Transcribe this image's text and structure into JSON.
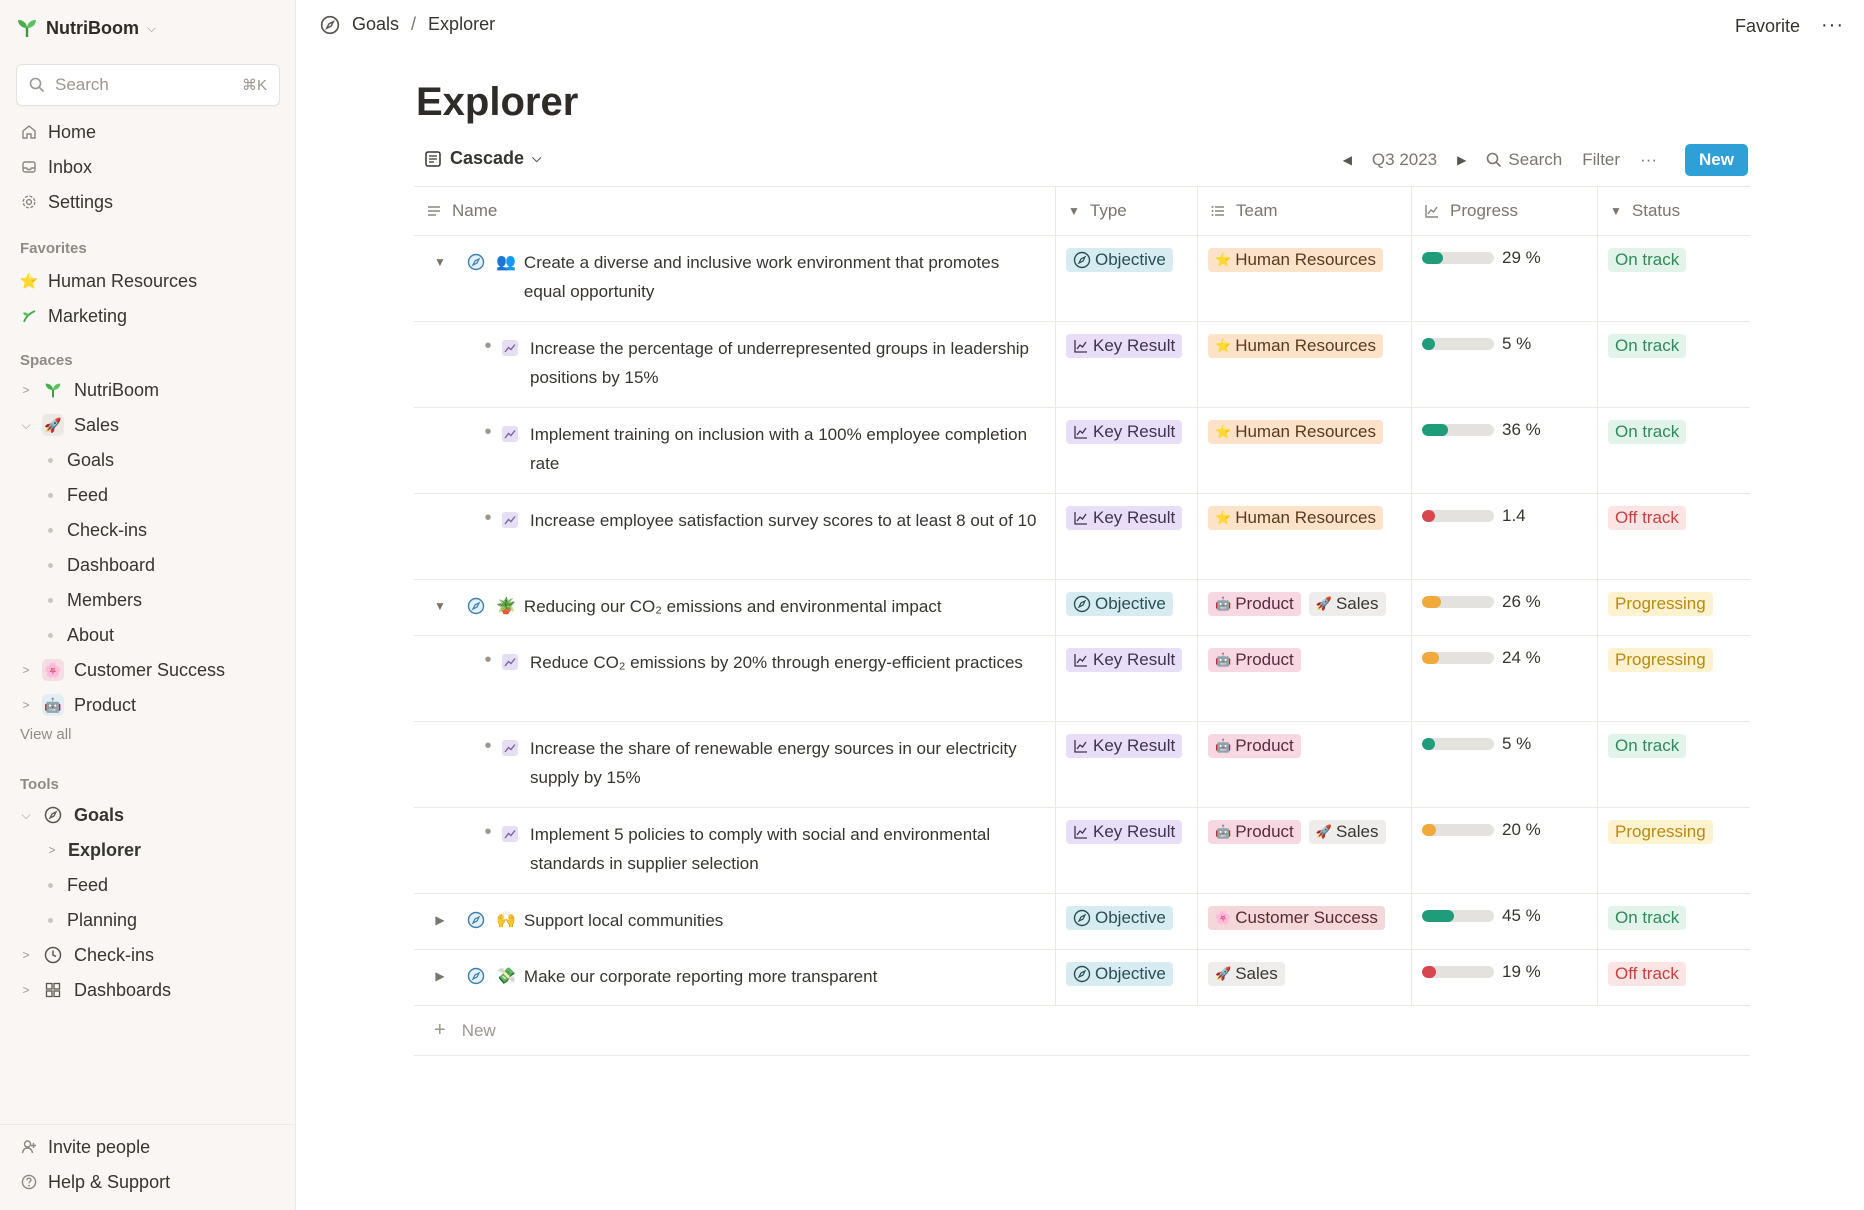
{
  "workspace": {
    "name": "NutriBoom"
  },
  "sidebar": {
    "search_placeholder": "Search",
    "search_shortcut": "⌘K",
    "nav": [
      {
        "label": "Home",
        "icon": "home-icon"
      },
      {
        "label": "Inbox",
        "icon": "inbox-icon"
      },
      {
        "label": "Settings",
        "icon": "gear-icon"
      }
    ],
    "favorites_heading": "Favorites",
    "favorites": [
      {
        "label": "Human Resources",
        "icon": "star-emoji"
      },
      {
        "label": "Marketing",
        "icon": "sprout-emoji"
      }
    ],
    "spaces_heading": "Spaces",
    "spaces": {
      "nutriboom": "NutriBoom",
      "sales": "Sales",
      "sales_children": [
        "Goals",
        "Feed",
        "Check-ins",
        "Dashboard",
        "Members",
        "About"
      ],
      "customer_success": "Customer Success",
      "product": "Product"
    },
    "view_all": "View all",
    "tools_heading": "Tools",
    "tools": {
      "goals": "Goals",
      "goals_children": [
        "Explorer",
        "Feed",
        "Planning"
      ],
      "checkins": "Check-ins",
      "dashboards": "Dashboards"
    },
    "bottom": {
      "invite": "Invite people",
      "help": "Help & Support"
    }
  },
  "topbar": {
    "breadcrumb": [
      "Goals",
      "Explorer"
    ],
    "breadcrumb_sep": "/",
    "favorite": "Favorite",
    "more": "···"
  },
  "page": {
    "title": "Explorer",
    "view": "Cascade",
    "period": "Q3 2023",
    "search": "Search",
    "filter": "Filter",
    "more": "···",
    "new_button": "New"
  },
  "table": {
    "columns": {
      "name": "Name",
      "type": "Type",
      "team": "Team",
      "progress": "Progress",
      "status": "Status"
    },
    "rows": [
      {
        "kind": "objective",
        "expanded": true,
        "emoji": "👥",
        "name": "Create a diverse and inclusive work environment that promotes equal opportunity",
        "type": "Objective",
        "teams": [
          {
            "label": "Human Resources",
            "emoji": "⭐",
            "cls": "tag-hr"
          }
        ],
        "progress": 0.29,
        "progress_label": "29 %",
        "status": "On track",
        "status_cls": "st-on",
        "color": "#1f9d7a",
        "height": 86
      },
      {
        "kind": "kr",
        "name": "Increase the percentage of underrepresented groups in leadership positions by 15%",
        "type": "Key Result",
        "teams": [
          {
            "label": "Human Resources",
            "emoji": "⭐",
            "cls": "tag-hr"
          }
        ],
        "progress": 0.05,
        "progress_label": "5 %",
        "status": "On track",
        "status_cls": "st-on",
        "color": "#1f9d7a",
        "height": 86
      },
      {
        "kind": "kr",
        "name": "Implement training on inclusion with a 100% employee completion rate",
        "type": "Key Result",
        "teams": [
          {
            "label": "Human Resources",
            "emoji": "⭐",
            "cls": "tag-hr"
          }
        ],
        "progress": 0.36,
        "progress_label": "36 %",
        "status": "On track",
        "status_cls": "st-on",
        "color": "#1f9d7a",
        "height": 86
      },
      {
        "kind": "kr",
        "name": "Increase employee satisfaction survey scores to at least 8 out of 10",
        "type": "Key Result",
        "teams": [
          {
            "label": "Human Resources",
            "emoji": "⭐",
            "cls": "tag-hr"
          }
        ],
        "progress": 0.1,
        "progress_label": "1.4",
        "status": "Off track",
        "status_cls": "st-off",
        "color": "#d9464f",
        "height": 86
      },
      {
        "kind": "objective",
        "expanded": true,
        "emoji": "🪴",
        "name": "Reducing our CO₂ emissions and environmental impact",
        "type": "Objective",
        "teams": [
          {
            "label": "Product",
            "emoji": "🤖",
            "cls": "tag-prod"
          },
          {
            "label": "Sales",
            "emoji": "🚀",
            "cls": "tag-sales"
          }
        ],
        "progress": 0.26,
        "progress_label": "26 %",
        "status": "Progressing",
        "status_cls": "st-prog",
        "color": "#f2a93b",
        "height": 56
      },
      {
        "kind": "kr",
        "name": "Reduce CO₂ emissions by 20% through energy-efficient practices",
        "type": "Key Result",
        "teams": [
          {
            "label": "Product",
            "emoji": "🤖",
            "cls": "tag-prod"
          }
        ],
        "progress": 0.24,
        "progress_label": "24 %",
        "status": "Progressing",
        "status_cls": "st-prog",
        "color": "#f2a93b",
        "height": 86
      },
      {
        "kind": "kr",
        "name": "Increase the share of renewable energy sources in our electricity supply by 15%",
        "type": "Key Result",
        "teams": [
          {
            "label": "Product",
            "emoji": "🤖",
            "cls": "tag-prod"
          }
        ],
        "progress": 0.05,
        "progress_label": "5 %",
        "status": "On track",
        "status_cls": "st-on",
        "color": "#1f9d7a",
        "height": 86
      },
      {
        "kind": "kr",
        "name": "Implement 5 policies to comply with social and environmental standards in supplier selection",
        "type": "Key Result",
        "teams": [
          {
            "label": "Product",
            "emoji": "🤖",
            "cls": "tag-prod"
          },
          {
            "label": "Sales",
            "emoji": "🚀",
            "cls": "tag-sales"
          }
        ],
        "progress": 0.2,
        "progress_label": "20 %",
        "status": "Progressing",
        "status_cls": "st-prog",
        "color": "#f2a93b",
        "height": 86
      },
      {
        "kind": "objective",
        "expanded": false,
        "emoji": "🙌",
        "name": "Support local communities",
        "type": "Objective",
        "teams": [
          {
            "label": "Customer Success",
            "emoji": "🌸",
            "cls": "tag-cs"
          }
        ],
        "progress": 0.45,
        "progress_label": "45 %",
        "status": "On track",
        "status_cls": "st-on",
        "color": "#1f9d7a",
        "height": 56
      },
      {
        "kind": "objective",
        "expanded": false,
        "emoji": "💸",
        "name": "Make our corporate reporting more transparent",
        "type": "Objective",
        "teams": [
          {
            "label": "Sales",
            "emoji": "🚀",
            "cls": "tag-sales"
          }
        ],
        "progress": 0.19,
        "progress_label": "19 %",
        "status": "Off track",
        "status_cls": "st-off",
        "color": "#d9464f",
        "height": 56
      }
    ],
    "new_row": "New"
  }
}
